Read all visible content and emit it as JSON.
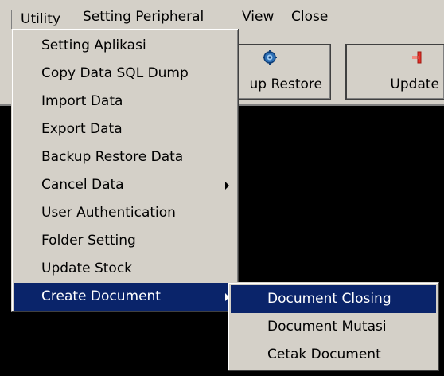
{
  "menubar": {
    "items": [
      {
        "label": "Utility"
      },
      {
        "label": "Setting Peripheral"
      },
      {
        "label": "View"
      },
      {
        "label": "Close"
      }
    ]
  },
  "toolbar": {
    "backup_label": "up Restore",
    "update_label": "Update",
    "backup_icon": "restore-icon",
    "update_icon": "update-icon"
  },
  "utility_menu": {
    "items": [
      {
        "label": "Setting Aplikasi"
      },
      {
        "label": "Copy Data SQL Dump"
      },
      {
        "label": "Import Data"
      },
      {
        "label": "Export Data"
      },
      {
        "label": "Backup Restore Data"
      },
      {
        "label": "Cancel Data",
        "has_submenu": true
      },
      {
        "label": "User Authentication"
      },
      {
        "label": "Folder Setting"
      },
      {
        "label": "Update Stock"
      },
      {
        "label": "Create Document",
        "has_submenu": true,
        "highlighted": true
      }
    ]
  },
  "create_document_submenu": {
    "items": [
      {
        "label": "Document Closing",
        "highlighted": true
      },
      {
        "label": "Document Mutasi"
      },
      {
        "label": "Cetak Document"
      }
    ]
  },
  "colors": {
    "face": "#d4d0c8",
    "highlight": "#0a246a",
    "content_background": "#000000"
  }
}
